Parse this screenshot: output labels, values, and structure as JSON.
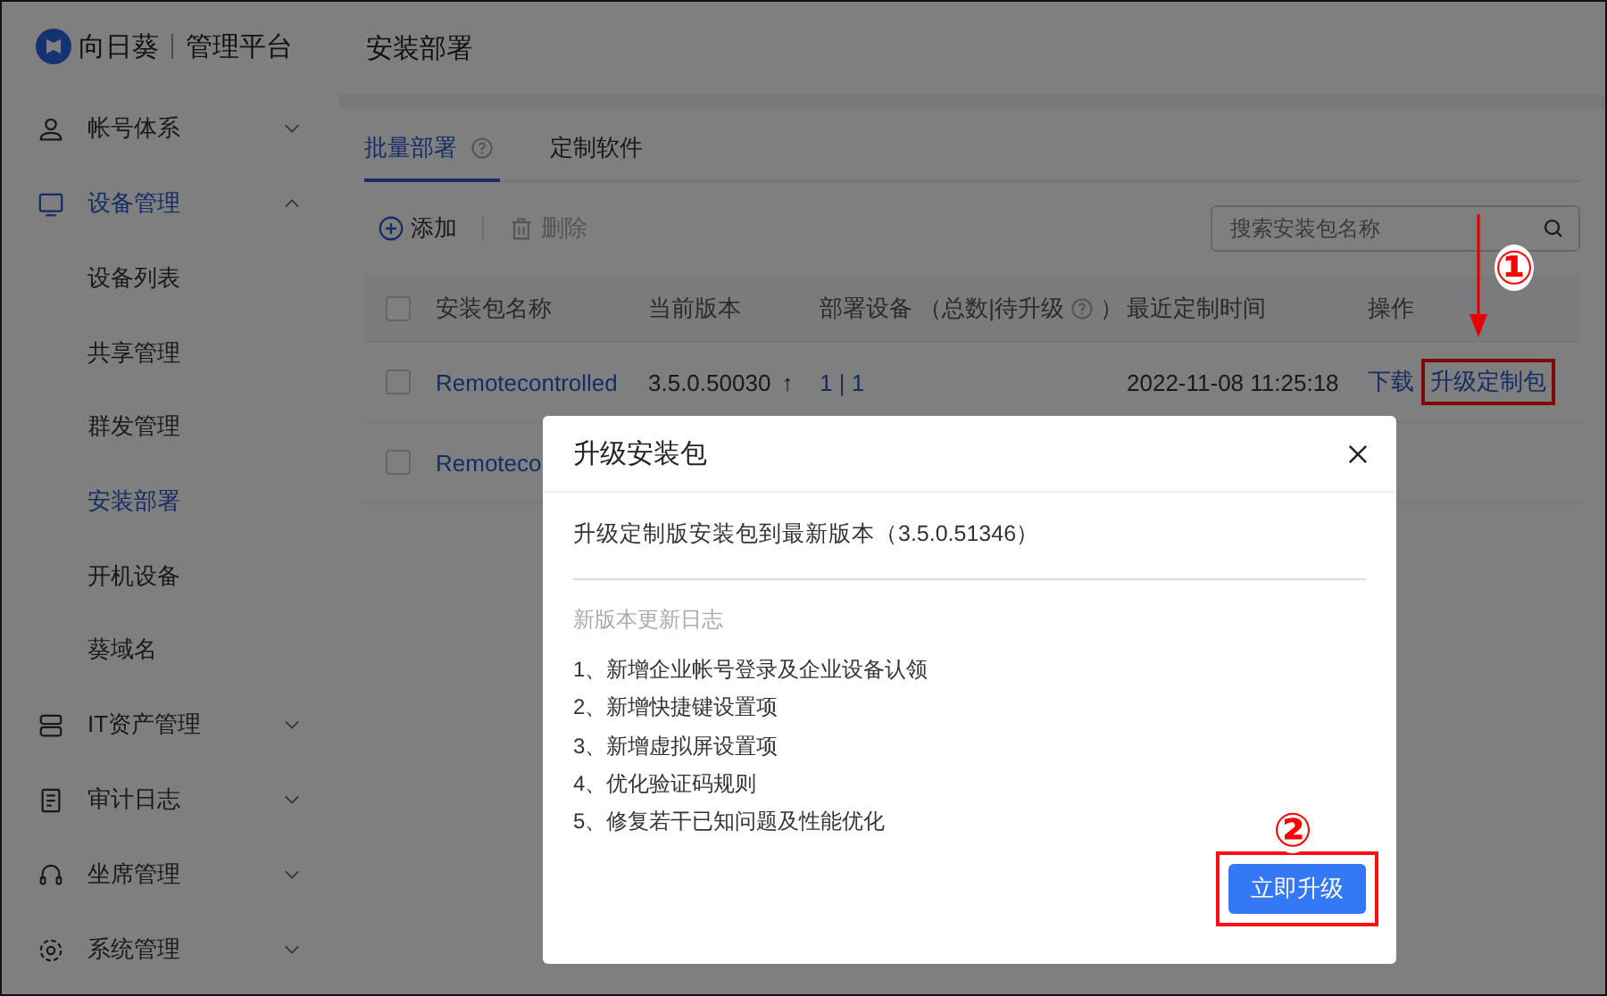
{
  "sidebar": {
    "logo": {
      "brand": "向日葵",
      "product": "管理平台"
    },
    "items": [
      {
        "label": "帐号体系",
        "expanded": false,
        "selected": false
      },
      {
        "label": "设备管理",
        "expanded": true,
        "selected": true,
        "children": [
          {
            "label": "设备列表",
            "selected": false
          },
          {
            "label": "共享管理",
            "selected": false
          },
          {
            "label": "群发管理",
            "selected": false
          },
          {
            "label": "安装部署",
            "selected": true
          },
          {
            "label": "开机设备",
            "selected": false
          },
          {
            "label": "葵域名",
            "selected": false
          }
        ]
      },
      {
        "label": "IT资产管理",
        "expanded": false,
        "selected": false
      },
      {
        "label": "审计日志",
        "expanded": false,
        "selected": false
      },
      {
        "label": "坐席管理",
        "expanded": false,
        "selected": false
      },
      {
        "label": "系统管理",
        "expanded": false,
        "selected": false
      }
    ]
  },
  "page": {
    "title": "安装部署"
  },
  "tabs": [
    {
      "label": "批量部署",
      "selected": true,
      "help": true
    },
    {
      "label": "定制软件",
      "selected": false,
      "help": false
    }
  ],
  "toolbar": {
    "add": {
      "label": "添加",
      "disabled": false
    },
    "delete": {
      "label": "删除",
      "disabled": true
    },
    "search": {
      "placeholder": "搜索安装包名称"
    }
  },
  "table": {
    "header_checked": false,
    "columns": [
      "安装包名称",
      "当前版本",
      "部署设备 （总数|待升级",
      "）",
      "最近定制时间",
      "操作"
    ],
    "rows": [
      {
        "checked": false,
        "name": "Remotecontrolled",
        "version": "3.5.0.50030",
        "version_mark": "↑",
        "devices": "1 | 1",
        "time": "2022-11-08 11:25:18",
        "actions": [
          {
            "label": "下载",
            "highlighted": false
          },
          {
            "label": "升级定制包",
            "highlighted": true
          }
        ]
      },
      {
        "checked": false,
        "name": "Remoteco"
      }
    ]
  },
  "dialog": {
    "title": "升级安装包",
    "message": "升级定制版安装包到最新版本（3.5.0.51346）",
    "log_title": "新版本更新日志",
    "log": [
      "1、新增企业帐号登录及企业设备认领",
      "2、新增快捷键设置项",
      "3、新增虚拟屏设置项",
      "4、优化验证码规则",
      "5、修复若干已知问题及性能优化"
    ],
    "button": {
      "label": "立即升级",
      "highlighted": true
    }
  },
  "annotations": [
    {
      "label": "①"
    },
    {
      "label": "②"
    }
  ]
}
